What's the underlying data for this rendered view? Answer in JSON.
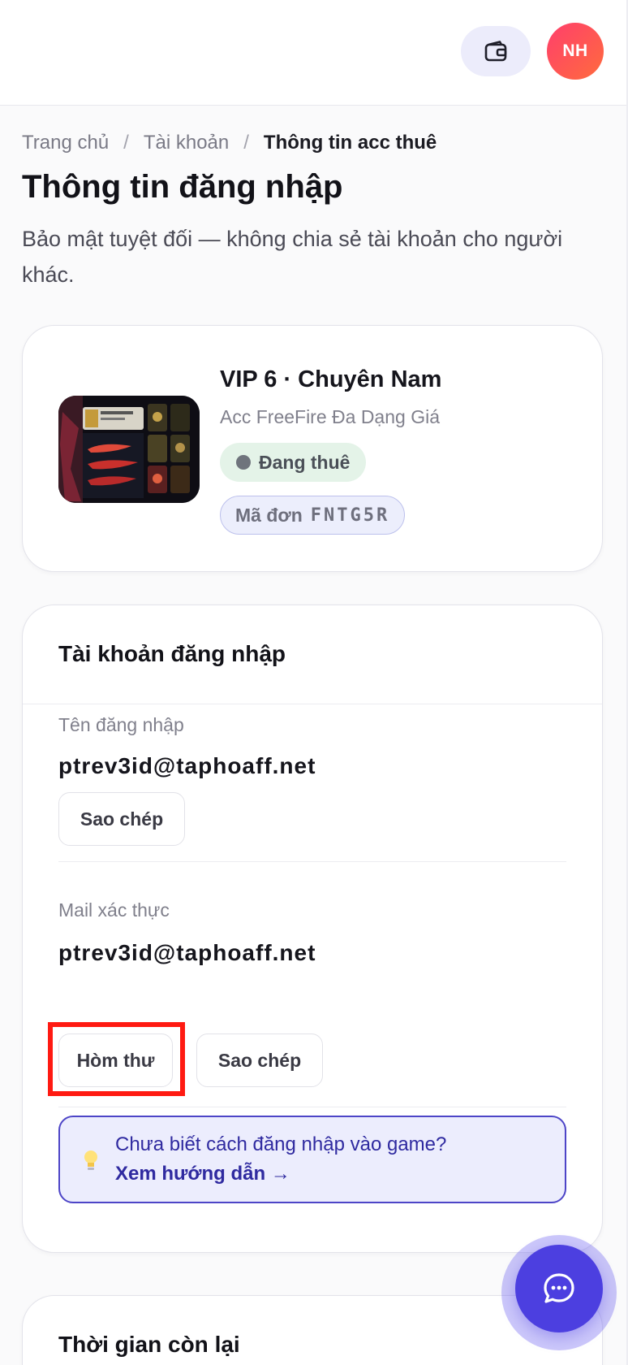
{
  "header": {
    "avatar_initials": "NH",
    "wallet_icon": "wallet-icon"
  },
  "breadcrumb": {
    "items": [
      "Trang chủ",
      "Tài khoản",
      "Thông tin acc thuê"
    ],
    "separator": "/"
  },
  "page": {
    "title": "Thông tin đăng nhập",
    "subtitle": "Bảo mật tuyệt đối — không chia sẻ tài khoản cho người khác."
  },
  "product": {
    "name": "VIP 6 · Chuyên Nam",
    "category": "Acc FreeFire Đa Dạng Giá",
    "status": "Đang thuê",
    "order_label": "Mã đơn",
    "order_code": "FNTG5R"
  },
  "login": {
    "section_title": "Tài khoản đăng nhập",
    "username_label": "Tên đăng nhập",
    "username_value": "ptrev3id@taphoaff.net",
    "copy_label": "Sao chép",
    "mail_label": "Mail xác thực",
    "mail_value": "ptrev3id@taphoaff.net",
    "inbox_label": "Hòm thư",
    "copy_mail_label": "Sao chép",
    "tip_text": "Chưa biết cách đăng nhập vào game?",
    "tip_link": "Xem hướng dẫn →"
  },
  "time": {
    "section_title": "Thời gian còn lại"
  },
  "colors": {
    "accent": "#4c3fe0",
    "avatar": "#ff3f6c",
    "status_bg": "#e4f3e8",
    "highlight": "#ff1a12"
  }
}
